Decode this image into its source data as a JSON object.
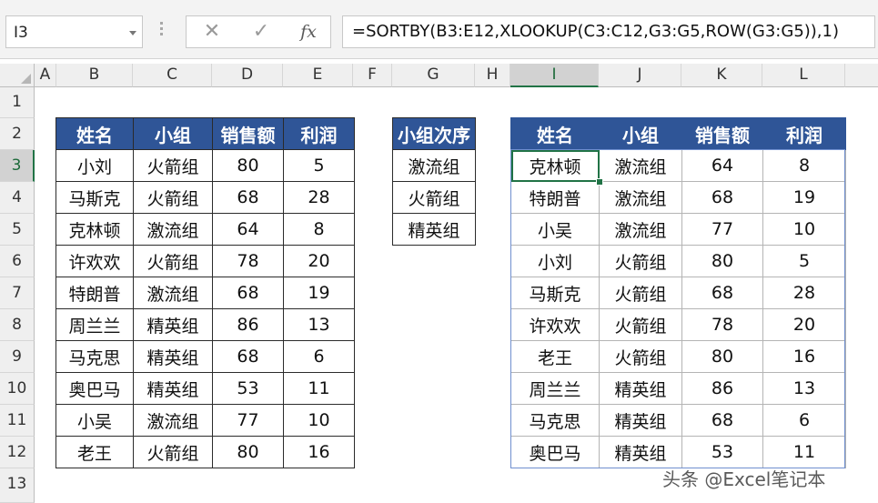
{
  "name_box": "I3",
  "formula_bar": {
    "cancel_icon": "close-icon",
    "enter_icon": "check-icon",
    "fx_label": "fx",
    "formula": "=SORTBY(B3:E12,XLOOKUP(C3:C12,G3:G5,ROW(G3:G5)),1)"
  },
  "columns": [
    "A",
    "B",
    "C",
    "D",
    "E",
    "F",
    "G",
    "H",
    "I",
    "J",
    "K",
    "L"
  ],
  "rows": [
    "1",
    "2",
    "3",
    "4",
    "5",
    "6",
    "7",
    "8",
    "9",
    "10",
    "11",
    "12",
    "13"
  ],
  "selected_cell": {
    "column": "I",
    "row": "3"
  },
  "source_table": {
    "headers": [
      "姓名",
      "小组",
      "销售额",
      "利润"
    ],
    "rows": [
      [
        "小刘",
        "火箭组",
        "80",
        "5"
      ],
      [
        "马斯克",
        "火箭组",
        "68",
        "28"
      ],
      [
        "克林顿",
        "激流组",
        "64",
        "8"
      ],
      [
        "许欢欢",
        "火箭组",
        "78",
        "20"
      ],
      [
        "特朗普",
        "激流组",
        "68",
        "19"
      ],
      [
        "周兰兰",
        "精英组",
        "86",
        "13"
      ],
      [
        "马克思",
        "精英组",
        "68",
        "6"
      ],
      [
        "奥巴马",
        "精英组",
        "53",
        "11"
      ],
      [
        "小吴",
        "激流组",
        "77",
        "10"
      ],
      [
        "老王",
        "火箭组",
        "80",
        "16"
      ]
    ]
  },
  "order_table": {
    "header": "小组次序",
    "rows": [
      "激流组",
      "火箭组",
      "精英组"
    ]
  },
  "result_table": {
    "headers": [
      "姓名",
      "小组",
      "销售额",
      "利润"
    ],
    "rows": [
      [
        "克林顿",
        "激流组",
        "64",
        "8"
      ],
      [
        "特朗普",
        "激流组",
        "68",
        "19"
      ],
      [
        "小吴",
        "激流组",
        "77",
        "10"
      ],
      [
        "小刘",
        "火箭组",
        "80",
        "5"
      ],
      [
        "马斯克",
        "火箭组",
        "68",
        "28"
      ],
      [
        "许欢欢",
        "火箭组",
        "78",
        "20"
      ],
      [
        "老王",
        "火箭组",
        "80",
        "16"
      ],
      [
        "周兰兰",
        "精英组",
        "86",
        "13"
      ],
      [
        "马克思",
        "精英组",
        "68",
        "6"
      ],
      [
        "奥巴马",
        "精英组",
        "53",
        "11"
      ]
    ]
  },
  "watermark": "头条 @Excel笔记本",
  "colors": {
    "header_fill": "#2f5597",
    "selection": "#217346"
  }
}
